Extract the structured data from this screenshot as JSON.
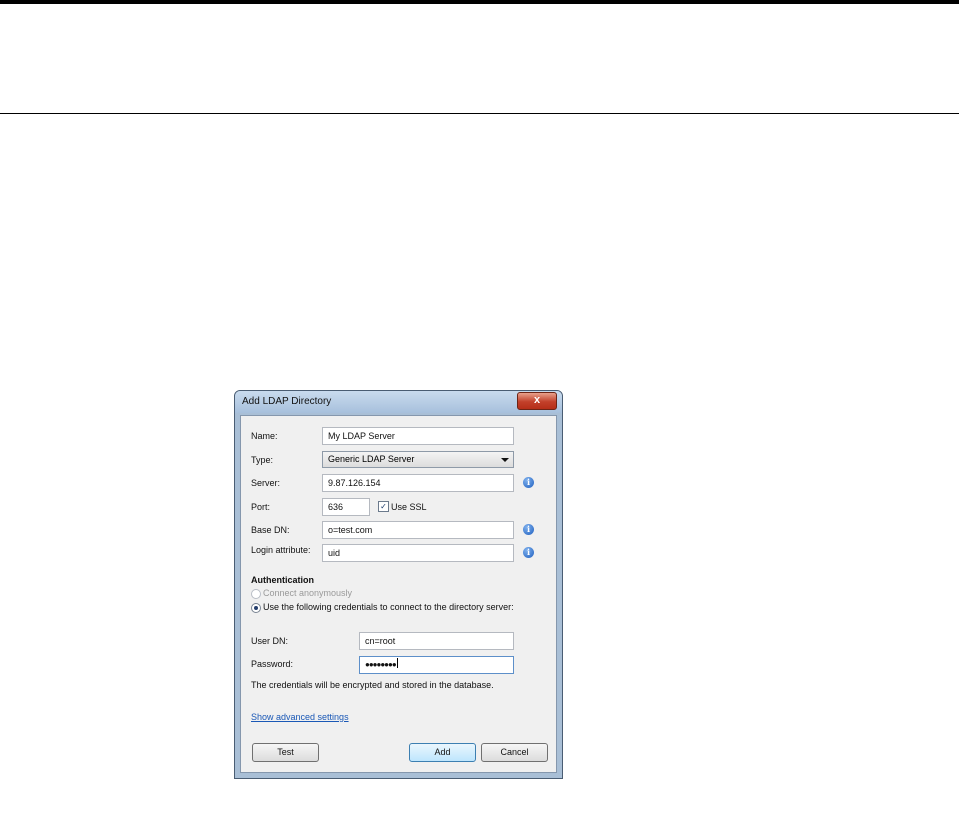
{
  "dialog": {
    "title": "Add LDAP Directory",
    "close_glyph": "x",
    "name_label": "Name:",
    "name_value": "My LDAP Server",
    "type_label": "Type:",
    "type_value": "Generic LDAP Server",
    "server_label": "Server:",
    "server_value": "9.87.126.154",
    "port_label": "Port:",
    "port_value": "636",
    "use_ssl_label": "Use SSL",
    "use_ssl_checked": true,
    "base_dn_label": "Base DN:",
    "base_dn_value": "o=test.com",
    "login_attr_label": "Login attribute:",
    "login_attr_value": "uid",
    "auth_heading": "Authentication",
    "anon_label": "Connect anonymously",
    "creds_label": "Use the following credentials to connect to the directory server:",
    "user_dn_label": "User DN:",
    "user_dn_value": "cn=root",
    "password_label": "Password:",
    "password_value": "●●●●●●●●",
    "note": "The credentials will be encrypted and stored in the database.",
    "advanced_link": "Show advanced settings",
    "test_button": "Test",
    "add_button": "Add",
    "cancel_button": "Cancel",
    "info_glyph": "i"
  },
  "icons": [
    "close-icon",
    "info-icon",
    "dropdown-arrow-icon",
    "checkbox-checked-icon",
    "radio-icon"
  ]
}
